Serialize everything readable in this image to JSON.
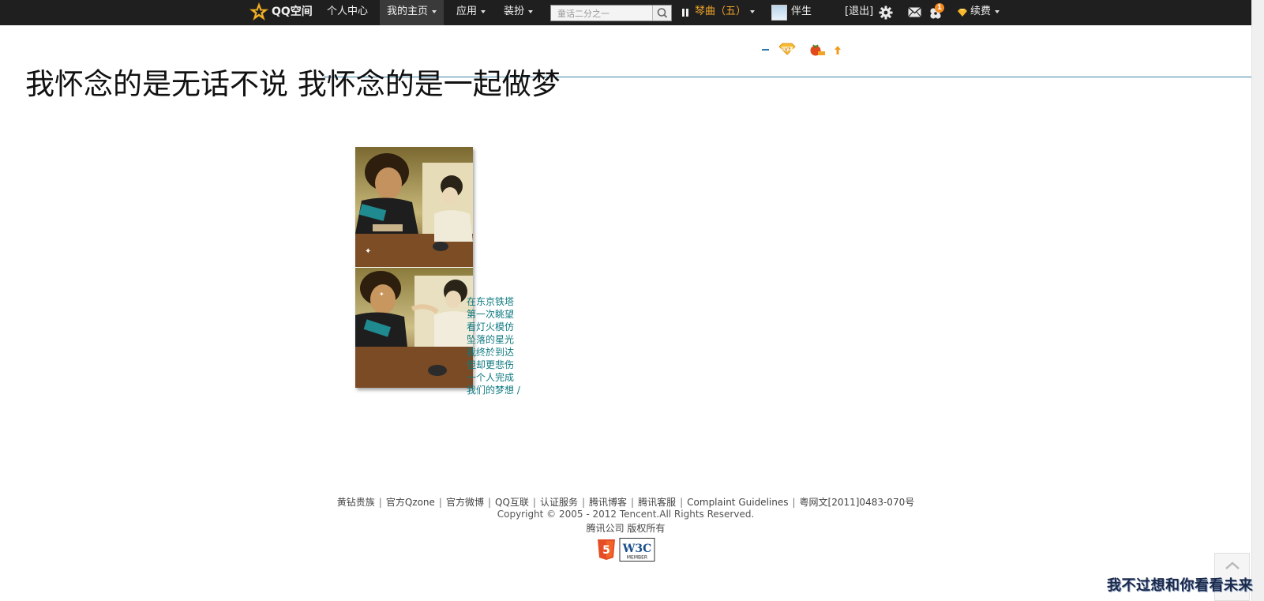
{
  "topbar": {
    "logo_text": "QQ空间",
    "nav": {
      "personal_center": "个人中心",
      "my_home": "我的主页",
      "apps": "应用",
      "decorate": "装扮"
    },
    "search": {
      "value": "童话二分之一"
    },
    "music": {
      "title": "琴曲（五）"
    },
    "user": {
      "name": "伴生",
      "logout": "[退出]"
    },
    "notifications": {
      "count": "1"
    },
    "renew": "续费",
    "colors": {
      "background": "#1f1f1f",
      "music_accent": "#f1a42a",
      "badge": "#f48a1e"
    }
  },
  "page": {
    "title": "我怀念的是无话不说  我怀念的是一起做梦"
  },
  "poem": {
    "lines": [
      "在东京铁塔",
      "第一次眺望",
      "看灯火模仿",
      "坠落的星光",
      "我终於到达",
      "但却更悲伤",
      "一个人完成",
      "我们的梦想  /"
    ],
    "color": "#0f7a80"
  },
  "footer": {
    "links": [
      "黄钻贵族",
      "官方Qzone",
      "官方微博",
      "QQ互联",
      "认证服务",
      "腾讯博客",
      "腾讯客服",
      "Complaint Guidelines",
      "粤网文[2011]0483-070号"
    ],
    "copyright": "Copyright © 2005 - 2012 Tencent.All Rights Reserved.",
    "company": "腾讯公司 版权所有",
    "badge_w3c": "W3C",
    "badge_w3c_sub": "MEMBER"
  },
  "corner": {
    "line1": "我不过想和你看看未来"
  },
  "icons": {
    "logo": "qzone-star-icon",
    "search": "magnifier-icon",
    "settings": "gear-icon",
    "mail": "envelope-icon",
    "clover": "clover-icon",
    "diamond": "diamond-icon"
  }
}
